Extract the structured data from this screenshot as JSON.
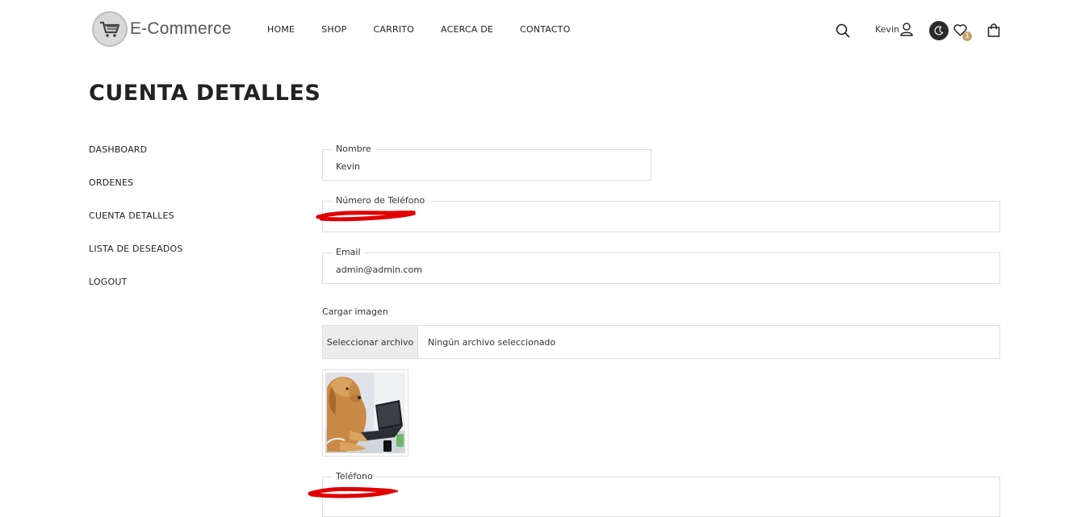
{
  "header": {
    "logo_text": "E-Commerce",
    "nav": [
      "HOME",
      "SHOP",
      "CARRITO",
      "ACERCA DE",
      "CONTACTO"
    ],
    "user_name": "Kevin",
    "wishlist_count": "1"
  },
  "page": {
    "title": "CUENTA DETALLES"
  },
  "sidebar": {
    "items": [
      "DASHBOARD",
      "ORDENES",
      "CUENTA DETALLES",
      "LISTA DE DESEADOS",
      "LOGOUT"
    ]
  },
  "form": {
    "name": {
      "label": "Nombre",
      "value": "Kevin"
    },
    "phone_number": {
      "label": "Número de Teléfono",
      "value": ""
    },
    "email": {
      "label": "Email",
      "value": "admin@admin.com"
    },
    "upload": {
      "label": "Cargar imagen",
      "button": "Seleccionar archivo",
      "status": "Ningún archivo seleccionado"
    },
    "phone": {
      "label": "Teléfono",
      "value": ""
    }
  },
  "colors": {
    "accent": "#c5a46d",
    "redaction": "#e00000",
    "text": "#222222",
    "border": "#dddddd"
  }
}
